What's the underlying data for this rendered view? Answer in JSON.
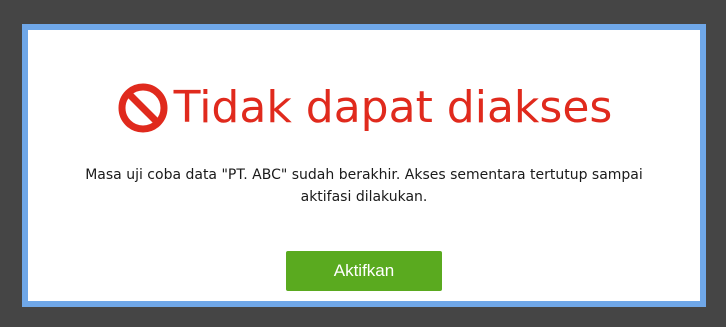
{
  "dialog": {
    "icon": "prohibited-icon",
    "title": "Tidak dapat diakses",
    "message": "Masa uji coba data \"PT. ABC\" sudah berakhir. Akses sementara tertutup sampai aktifasi dilakukan.",
    "activate_label": "Aktifkan"
  },
  "colors": {
    "overlay": "#454545",
    "dialog_border": "#6fa7e8",
    "title": "#e02a1d",
    "button": "#5aaa1f"
  }
}
